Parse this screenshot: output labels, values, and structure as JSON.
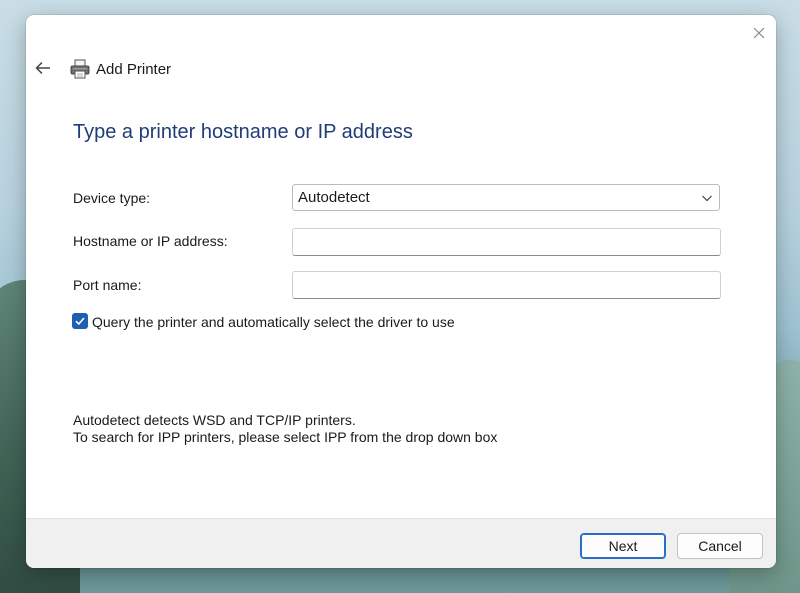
{
  "window": {
    "title": "Add Printer"
  },
  "page": {
    "heading": "Type a printer hostname or IP address"
  },
  "form": {
    "device_type_label": "Device type:",
    "device_type_value": "Autodetect",
    "hostname_label": "Hostname or IP address:",
    "hostname_value": "",
    "port_label": "Port name:",
    "port_value": "",
    "query_checkbox_label": "Query the printer and automatically select the driver to use",
    "query_checked": true
  },
  "info": {
    "line1": "Autodetect detects WSD and TCP/IP printers.",
    "line2": "To search for IPP printers, please select IPP from the drop down box"
  },
  "footer": {
    "next_label": "Next",
    "cancel_label": "Cancel"
  },
  "colors": {
    "heading": "#1f3d78",
    "accent": "#1f5fb0",
    "annotation_arrow": "#d42a2a"
  },
  "icons": {
    "close": "close-icon",
    "back": "back-arrow-icon",
    "printer": "printer-icon",
    "dropdown": "chevron-down-icon",
    "check": "checkmark-icon",
    "annotation": "red-arrow-icon"
  }
}
